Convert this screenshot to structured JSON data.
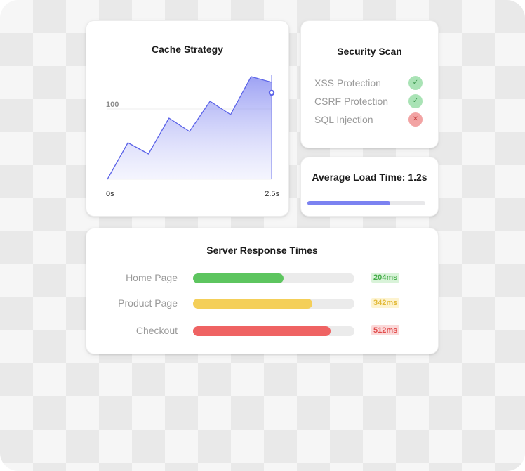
{
  "cache_card": {
    "title": "Cache Strategy",
    "chart_data": {
      "type": "area",
      "title": "Cache Strategy",
      "x_start_label": "0s",
      "x_end_label": "2.5s",
      "y_reference_label": "100",
      "y_reference_value": 100,
      "ylim": [
        0,
        150
      ],
      "values": [
        0,
        52,
        36,
        87,
        68,
        111,
        92,
        146,
        138
      ],
      "color": "#5b63e8"
    }
  },
  "security_scan": {
    "title": "Security Scan",
    "items": [
      {
        "label": "XSS Protection",
        "status": "pass",
        "glyph": "✓"
      },
      {
        "label": "CSRF Protection",
        "status": "pass",
        "glyph": "✓"
      },
      {
        "label": "SQL Injection",
        "status": "fail",
        "glyph": "✕"
      }
    ]
  },
  "load_time": {
    "title": "Average Load Time: 1.2s",
    "progress": 0.7,
    "color": "#7b82f1"
  },
  "server_response": {
    "title": "Server Response Times",
    "rows": [
      {
        "label": "Home Page",
        "value": "204ms",
        "fraction": 0.56,
        "color": "#5dc55f",
        "badge_bg": "#d9f3d9",
        "badge_fg": "#45ad49"
      },
      {
        "label": "Product Page",
        "value": "342ms",
        "fraction": 0.74,
        "color": "#f4cf59",
        "badge_bg": "#fdf3cf",
        "badge_fg": "#e2b937"
      },
      {
        "label": "Checkout",
        "value": "512ms",
        "fraction": 0.85,
        "color": "#ef6363",
        "badge_bg": "#fbd9d9",
        "badge_fg": "#e14c4c"
      }
    ]
  }
}
